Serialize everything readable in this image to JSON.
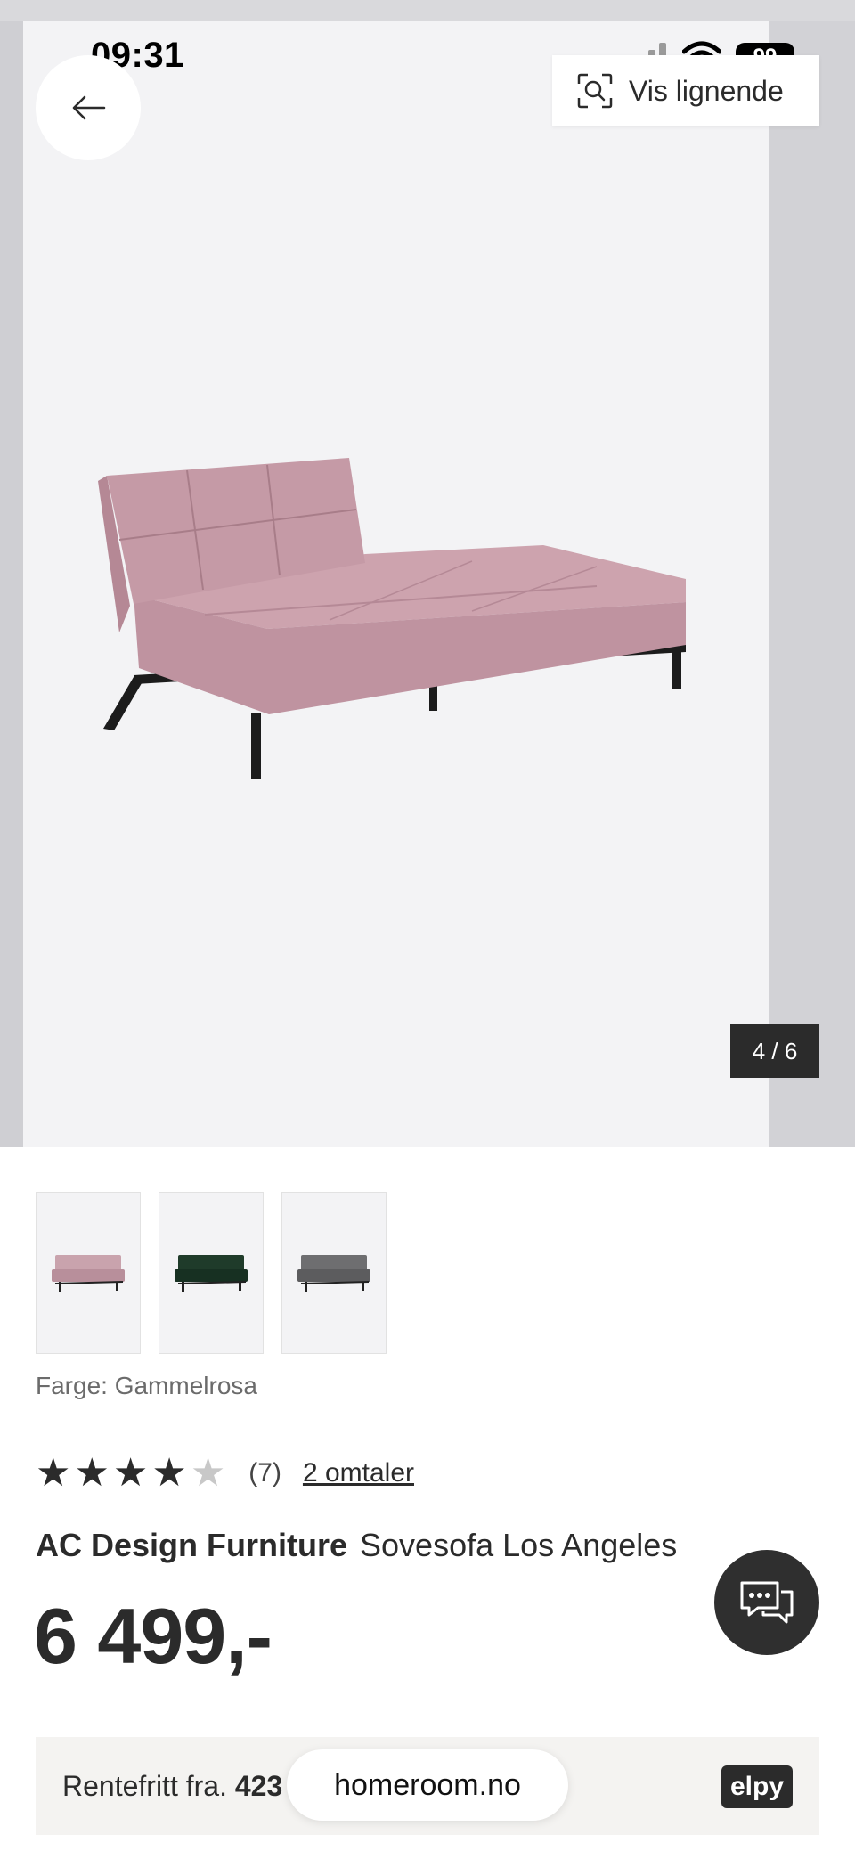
{
  "status_bar": {
    "time": "09:31",
    "battery": "99"
  },
  "header": {
    "similar_label": "Vis lignende"
  },
  "gallery": {
    "counter": "4 / 6"
  },
  "thumbnails": [
    {
      "name": "thumb-pink-sofa",
      "color": "#c9a3ad"
    },
    {
      "name": "thumb-green-sofa",
      "color": "#1f3b2a"
    },
    {
      "name": "thumb-grey-sofa",
      "color": "#6e6e70"
    }
  ],
  "product": {
    "color_label": "Farge: Gammelrosa",
    "rating_value": 4,
    "rating_max": 5,
    "rating_count": "(7)",
    "reviews_link": "2 omtaler",
    "brand": "AC Design Furniture",
    "name": "Sovesofa Los Angeles",
    "price": "6 499,-"
  },
  "finance": {
    "prefix": "Rentefritt fra.",
    "amount": "423",
    "provider": "elpy"
  },
  "browser": {
    "url": "homeroom.no"
  },
  "colors": {
    "accent": "#2b2b2b",
    "sofa_pink": "#cfa5b0"
  }
}
